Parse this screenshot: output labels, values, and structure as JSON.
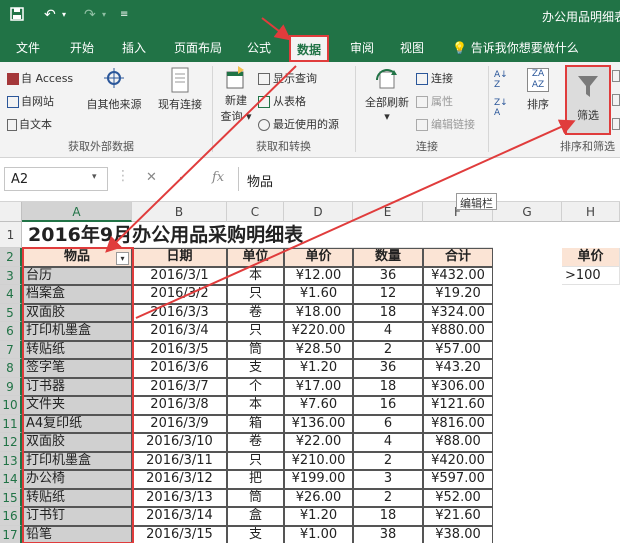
{
  "window": {
    "title": "办公用品明细表"
  },
  "tabs": [
    {
      "label": "文件"
    },
    {
      "label": "开始"
    },
    {
      "label": "插入"
    },
    {
      "label": "页面布局"
    },
    {
      "label": "公式"
    },
    {
      "label": "数据"
    },
    {
      "label": "审阅"
    },
    {
      "label": "视图"
    }
  ],
  "tellme": "告诉我你想要做什么",
  "ribbon": {
    "external": {
      "access": "自 Access",
      "web": "自网站",
      "text": "自文本",
      "other": "自其他来源",
      "existing": "现有连接",
      "group": "获取外部数据"
    },
    "transform": {
      "newquery_line1": "新建",
      "newquery_line2": "查询",
      "showquery": "显示查询",
      "fromtable": "从表格",
      "recent": "最近使用的源",
      "group": "获取和转换"
    },
    "connections": {
      "refresh": "全部刷新",
      "connections": "连接",
      "properties": "属性",
      "editlinks": "编辑链接",
      "group": "连接"
    },
    "sort": {
      "sort": "排序",
      "filter": "筛选",
      "group": "排序和筛选"
    }
  },
  "formula_bar": {
    "namebox": "A2",
    "content": "物品",
    "fx": "fx",
    "tooltip": "编辑栏"
  },
  "sheet": {
    "columns": [
      "A",
      "B",
      "C",
      "D",
      "E",
      "F",
      "G",
      "H"
    ],
    "title": "2016年9月办公用品采购明细表",
    "headers": [
      "物品",
      "日期",
      "单位",
      "单价",
      "数量",
      "合计"
    ],
    "side_header": "单价",
    "side_value": ">100",
    "rows": [
      {
        "n": 3,
        "item": "台历",
        "date": "2016/3/1",
        "unit": "本",
        "price": "¥12.00",
        "qty": "36",
        "total": "¥432.00"
      },
      {
        "n": 4,
        "item": "档案盒",
        "date": "2016/3/2",
        "unit": "只",
        "price": "¥1.60",
        "qty": "12",
        "total": "¥19.20"
      },
      {
        "n": 5,
        "item": "双面胶",
        "date": "2016/3/3",
        "unit": "卷",
        "price": "¥18.00",
        "qty": "18",
        "total": "¥324.00"
      },
      {
        "n": 6,
        "item": "打印机墨盒",
        "date": "2016/3/4",
        "unit": "只",
        "price": "¥220.00",
        "qty": "4",
        "total": "¥880.00"
      },
      {
        "n": 7,
        "item": "转贴纸",
        "date": "2016/3/5",
        "unit": "筒",
        "price": "¥28.50",
        "qty": "2",
        "total": "¥57.00"
      },
      {
        "n": 8,
        "item": "签字笔",
        "date": "2016/3/6",
        "unit": "支",
        "price": "¥1.20",
        "qty": "36",
        "total": "¥43.20"
      },
      {
        "n": 9,
        "item": "订书器",
        "date": "2016/3/7",
        "unit": "个",
        "price": "¥17.00",
        "qty": "18",
        "total": "¥306.00"
      },
      {
        "n": 10,
        "item": "文件夹",
        "date": "2016/3/8",
        "unit": "本",
        "price": "¥7.60",
        "qty": "16",
        "total": "¥121.60"
      },
      {
        "n": 11,
        "item": "A4复印纸",
        "date": "2016/3/9",
        "unit": "箱",
        "price": "¥136.00",
        "qty": "6",
        "total": "¥816.00"
      },
      {
        "n": 12,
        "item": "双面胶",
        "date": "2016/3/10",
        "unit": "卷",
        "price": "¥22.00",
        "qty": "4",
        "total": "¥88.00"
      },
      {
        "n": 13,
        "item": "打印机墨盒",
        "date": "2016/3/11",
        "unit": "只",
        "price": "¥210.00",
        "qty": "2",
        "total": "¥420.00"
      },
      {
        "n": 14,
        "item": "办公椅",
        "date": "2016/3/12",
        "unit": "把",
        "price": "¥199.00",
        "qty": "3",
        "total": "¥597.00"
      },
      {
        "n": 15,
        "item": "转贴纸",
        "date": "2016/3/13",
        "unit": "筒",
        "price": "¥26.00",
        "qty": "2",
        "total": "¥52.00"
      },
      {
        "n": 16,
        "item": "订书钉",
        "date": "2016/3/14",
        "unit": "盒",
        "price": "¥1.20",
        "qty": "18",
        "total": "¥21.60"
      },
      {
        "n": 17,
        "item": "铅笔",
        "date": "2016/3/15",
        "unit": "支",
        "price": "¥1.00",
        "qty": "38",
        "total": "¥38.00"
      }
    ]
  },
  "colors": {
    "excel_green": "#217346",
    "annotation_red": "#e03c3c",
    "header_fill": "#fbe4d5"
  }
}
